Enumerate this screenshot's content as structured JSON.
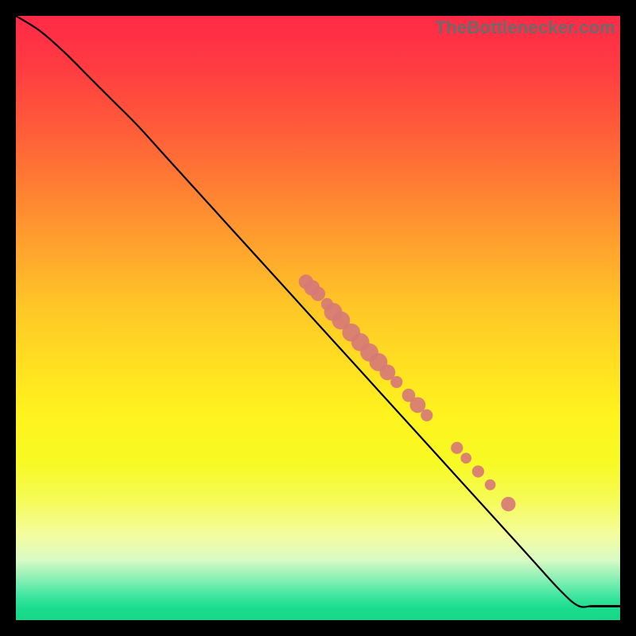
{
  "watermark": "TheBottlenecker.com",
  "colors": {
    "dot": "#d77a76",
    "curve": "#000000"
  },
  "chart_data": {
    "type": "line",
    "title": "",
    "xlabel": "",
    "ylabel": "",
    "xlim": [
      0,
      100
    ],
    "ylim": [
      0,
      100
    ],
    "grid": false,
    "series": [
      {
        "name": "curve",
        "x": [
          0,
          4,
          8,
          12,
          16,
          20,
          25,
          30,
          35,
          40,
          45,
          50,
          55,
          60,
          65,
          70,
          75,
          80,
          85,
          90,
          93,
          95
        ],
        "y": [
          100,
          97.5,
          94,
          90,
          86,
          82,
          76.5,
          71,
          65.5,
          60,
          54.5,
          49,
          43.5,
          38,
          32.5,
          27,
          21.5,
          16,
          10.5,
          5,
          2.4,
          2.3
        ]
      },
      {
        "name": "flat_tail",
        "x": [
          95,
          100
        ],
        "y": [
          2.3,
          2.3
        ]
      }
    ],
    "highlight_points": {
      "name": "cluster",
      "points": [
        {
          "x": 48.0,
          "y": 56.0,
          "r": 1.2
        },
        {
          "x": 49.0,
          "y": 55.0,
          "r": 1.3
        },
        {
          "x": 50.0,
          "y": 54.0,
          "r": 1.2
        },
        {
          "x": 51.5,
          "y": 52.3,
          "r": 1.0
        },
        {
          "x": 52.5,
          "y": 51.0,
          "r": 1.5
        },
        {
          "x": 53.8,
          "y": 49.6,
          "r": 1.5
        },
        {
          "x": 55.5,
          "y": 47.6,
          "r": 1.5
        },
        {
          "x": 57.0,
          "y": 46.0,
          "r": 1.5
        },
        {
          "x": 58.5,
          "y": 44.3,
          "r": 1.5
        },
        {
          "x": 60.0,
          "y": 42.7,
          "r": 1.5
        },
        {
          "x": 61.5,
          "y": 41.0,
          "r": 1.3
        },
        {
          "x": 63.0,
          "y": 39.4,
          "r": 1.0
        },
        {
          "x": 65.0,
          "y": 37.2,
          "r": 1.1
        },
        {
          "x": 66.5,
          "y": 35.6,
          "r": 1.3
        },
        {
          "x": 68.0,
          "y": 33.9,
          "r": 1.0
        },
        {
          "x": 73.0,
          "y": 28.5,
          "r": 1.0
        },
        {
          "x": 74.5,
          "y": 26.8,
          "r": 0.9
        },
        {
          "x": 76.5,
          "y": 24.6,
          "r": 1.0
        },
        {
          "x": 78.5,
          "y": 22.4,
          "r": 0.9
        },
        {
          "x": 81.5,
          "y": 19.2,
          "r": 1.2
        }
      ]
    }
  }
}
